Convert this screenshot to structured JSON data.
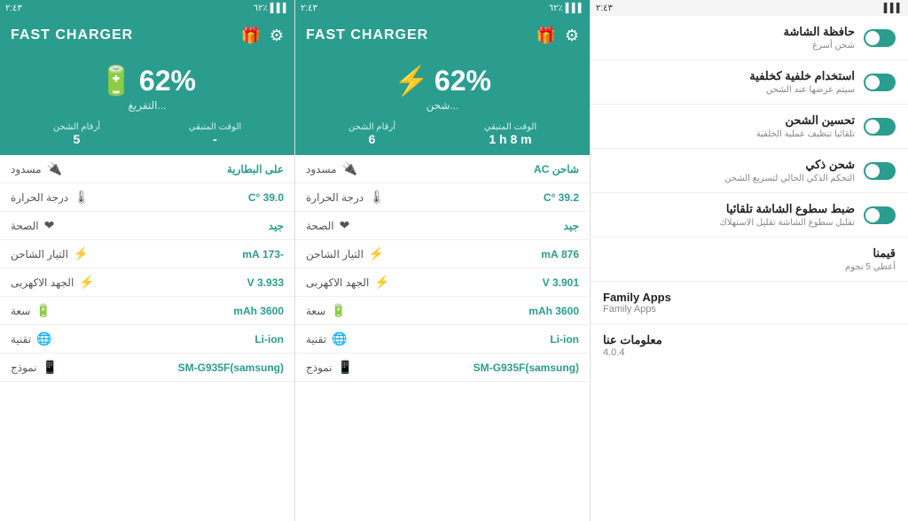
{
  "colors": {
    "teal": "#2a9d8f",
    "teal_light": "#d0f0ec",
    "text_dark": "#222",
    "text_muted": "#888",
    "text_value": "#2a9d8f",
    "text_blocked": "#666"
  },
  "panel1": {
    "status_bar": {
      "time": "٢:٤٣",
      "battery": "٦٢٪",
      "signal": "لل"
    },
    "header": {
      "title": "FAST CHARGER",
      "gift_icon": "🎁",
      "settings_icon": "⚙"
    },
    "battery": {
      "percent": "62%",
      "status": "التفريغ...",
      "charging_numbers_label": "أرقام الشحن",
      "remaining_time_label": "الوقت المتبقي",
      "charging_numbers_value": "5",
      "remaining_time_value": "-"
    },
    "stats": [
      {
        "icon": "🔌",
        "label": "مسدود",
        "value": "على البطارية",
        "value_type": "teal"
      },
      {
        "icon": "🌡",
        "label": "درجة الحرارة",
        "value": "39.0 °C",
        "value_type": "teal"
      },
      {
        "icon": "❤",
        "label": "الصحة",
        "value": "جيد",
        "value_type": "teal"
      },
      {
        "icon": "⚡",
        "label": "التيار الشاحن",
        "value": "-173 mA",
        "value_type": "teal"
      },
      {
        "icon": "⚡",
        "label": "الجهد الاكهربى",
        "value": "3.933 V",
        "value_type": "teal"
      },
      {
        "icon": "🔋",
        "label": "سعة",
        "value": "3600 mAh",
        "value_type": "teal"
      },
      {
        "icon": "🌐",
        "label": "تقنية",
        "value": "Li-ion",
        "value_type": "teal"
      },
      {
        "icon": "📱",
        "label": "نموذج",
        "value": "SM-G935F(samsung)",
        "value_type": "teal"
      }
    ]
  },
  "panel2": {
    "status_bar": {
      "time": "٢:٤٣",
      "battery": "٦٢٪"
    },
    "header": {
      "title": "FAST CHARGER",
      "gift_icon": "🎁",
      "settings_icon": "⚙"
    },
    "battery": {
      "percent": "62%",
      "status": "شحن...",
      "charging_numbers_label": "أرقام الشحن",
      "remaining_time_label": "الوقت المتبقي",
      "charging_numbers_value": "6",
      "remaining_time_value": "1 h 8 m"
    },
    "stats": [
      {
        "icon": "🔌",
        "label": "مسدود",
        "value": "شاحن AC",
        "value_type": "teal"
      },
      {
        "icon": "🌡",
        "label": "درجة الحرارة",
        "value": "39.2 °C",
        "value_type": "teal"
      },
      {
        "icon": "❤",
        "label": "الصحة",
        "value": "جيد",
        "value_type": "teal"
      },
      {
        "icon": "⚡",
        "label": "التيار الشاحن",
        "value": "876 mA",
        "value_type": "teal"
      },
      {
        "icon": "⚡",
        "label": "الجهد الاكهربى",
        "value": "3.901 V",
        "value_type": "teal"
      },
      {
        "icon": "🔋",
        "label": "سعة",
        "value": "3600 mAh",
        "value_type": "teal"
      },
      {
        "icon": "🌐",
        "label": "تقنية",
        "value": "Li-ion",
        "value_type": "teal"
      },
      {
        "icon": "📱",
        "label": "نموذج",
        "value": "SM-G935F(samsung)",
        "value_type": "teal"
      }
    ]
  },
  "settings": {
    "status_bar": {
      "time": "٢:٤٣"
    },
    "items": [
      {
        "title": "حافظة الشاشة",
        "subtitle": "شحن أسرع",
        "has_toggle": true
      },
      {
        "title": "استخدام خلفية كخلفية",
        "subtitle": "سيتم عرضها عند الشحن",
        "has_toggle": true
      },
      {
        "title": "تحسين الشحن",
        "subtitle": "تلقائيا تنظيف عملية الخلفية",
        "has_toggle": true
      },
      {
        "title": "شحن ذكي",
        "subtitle": "التحكم الذكي الحالي لتسريع الشحن",
        "has_toggle": true
      },
      {
        "title": "ضبط سطوع الشاشة تلقائيا",
        "subtitle": "تقليل سطوع الشاشة تقليل الاستهلاك",
        "has_toggle": true
      },
      {
        "title": "قيمنا",
        "subtitle": "أعطي 5 نجوم",
        "has_toggle": false
      }
    ],
    "family_apps": {
      "title": "Family Apps",
      "subtitle": "Family Apps"
    },
    "about": {
      "title": "معلومات عنا",
      "subtitle": "4.0.4"
    }
  }
}
